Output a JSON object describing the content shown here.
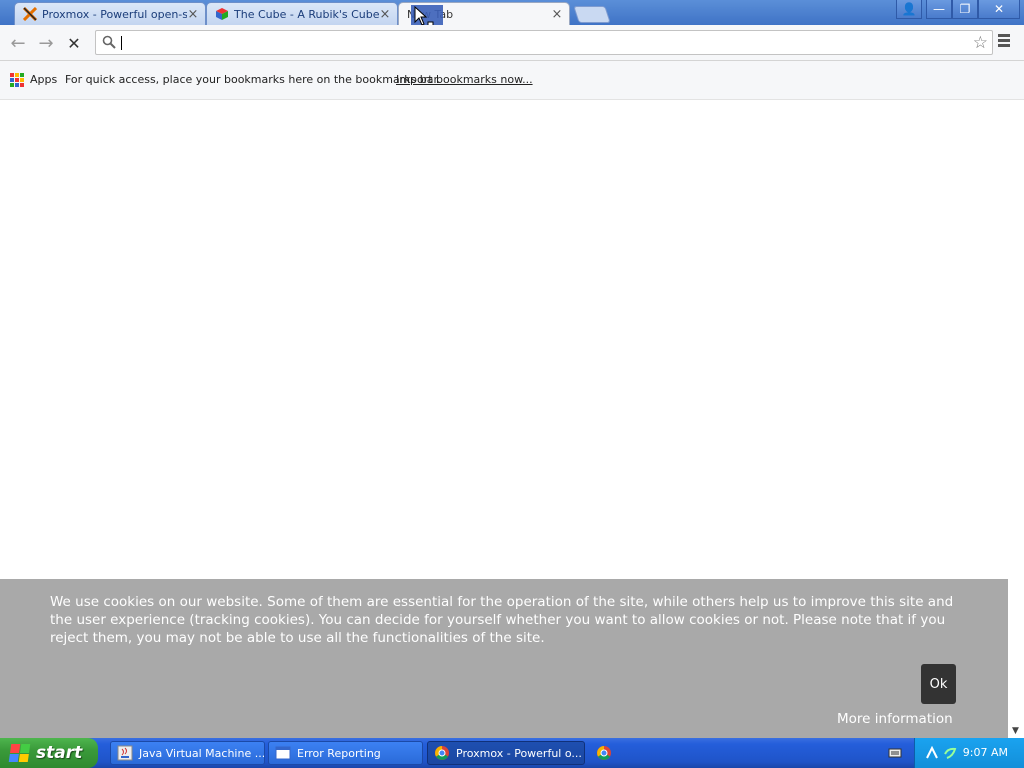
{
  "tabs": [
    {
      "title": "Proxmox - Powerful open-so",
      "icon": "proxmox-icon",
      "close": "×"
    },
    {
      "title": "The Cube - A Rubik's Cube G",
      "icon": "rubik-cube-icon",
      "close": "×"
    },
    {
      "title": "New Tab",
      "icon": "",
      "close": "×"
    }
  ],
  "window_buttons": {
    "profile": "👤",
    "minimize": "—",
    "restore": "❐",
    "close": "✕"
  },
  "toolbar": {
    "back": "←",
    "forward": "→",
    "stop": "✕",
    "omnibox_value": "",
    "omnibox_placeholder": "",
    "star": "☆"
  },
  "bookmarks_bar": {
    "apps_label": "Apps",
    "hint": "For quick access, place your bookmarks here on the bookmarks bar.",
    "import_link": "Import bookmarks now..."
  },
  "cookie_banner": {
    "text": "We use cookies on our website. Some of them are essential for the operation of the site, while others help us to improve this site and the user experience (tracking cookies). You can decide for yourself whether you want to allow cookies or not. Please note that if you reject them, you may not be able to use all the functionalities of the site.",
    "ok_label": "Ok",
    "more_info": "More information"
  },
  "taskbar": {
    "start_label": "start",
    "tasks": [
      {
        "label": "Java Virtual Machine ...",
        "icon": "java-icon"
      },
      {
        "label": "Error Reporting",
        "icon": "window-icon"
      },
      {
        "label": "Proxmox - Powerful o...",
        "icon": "chrome-icon"
      }
    ],
    "clock": "9:07 AM"
  },
  "colors": {
    "accent": "#3f73c6",
    "cookie_bg": "#a9a9a9",
    "ok_bg": "#333333",
    "taskbar": "#245edb",
    "start": "#3a9a3a"
  }
}
